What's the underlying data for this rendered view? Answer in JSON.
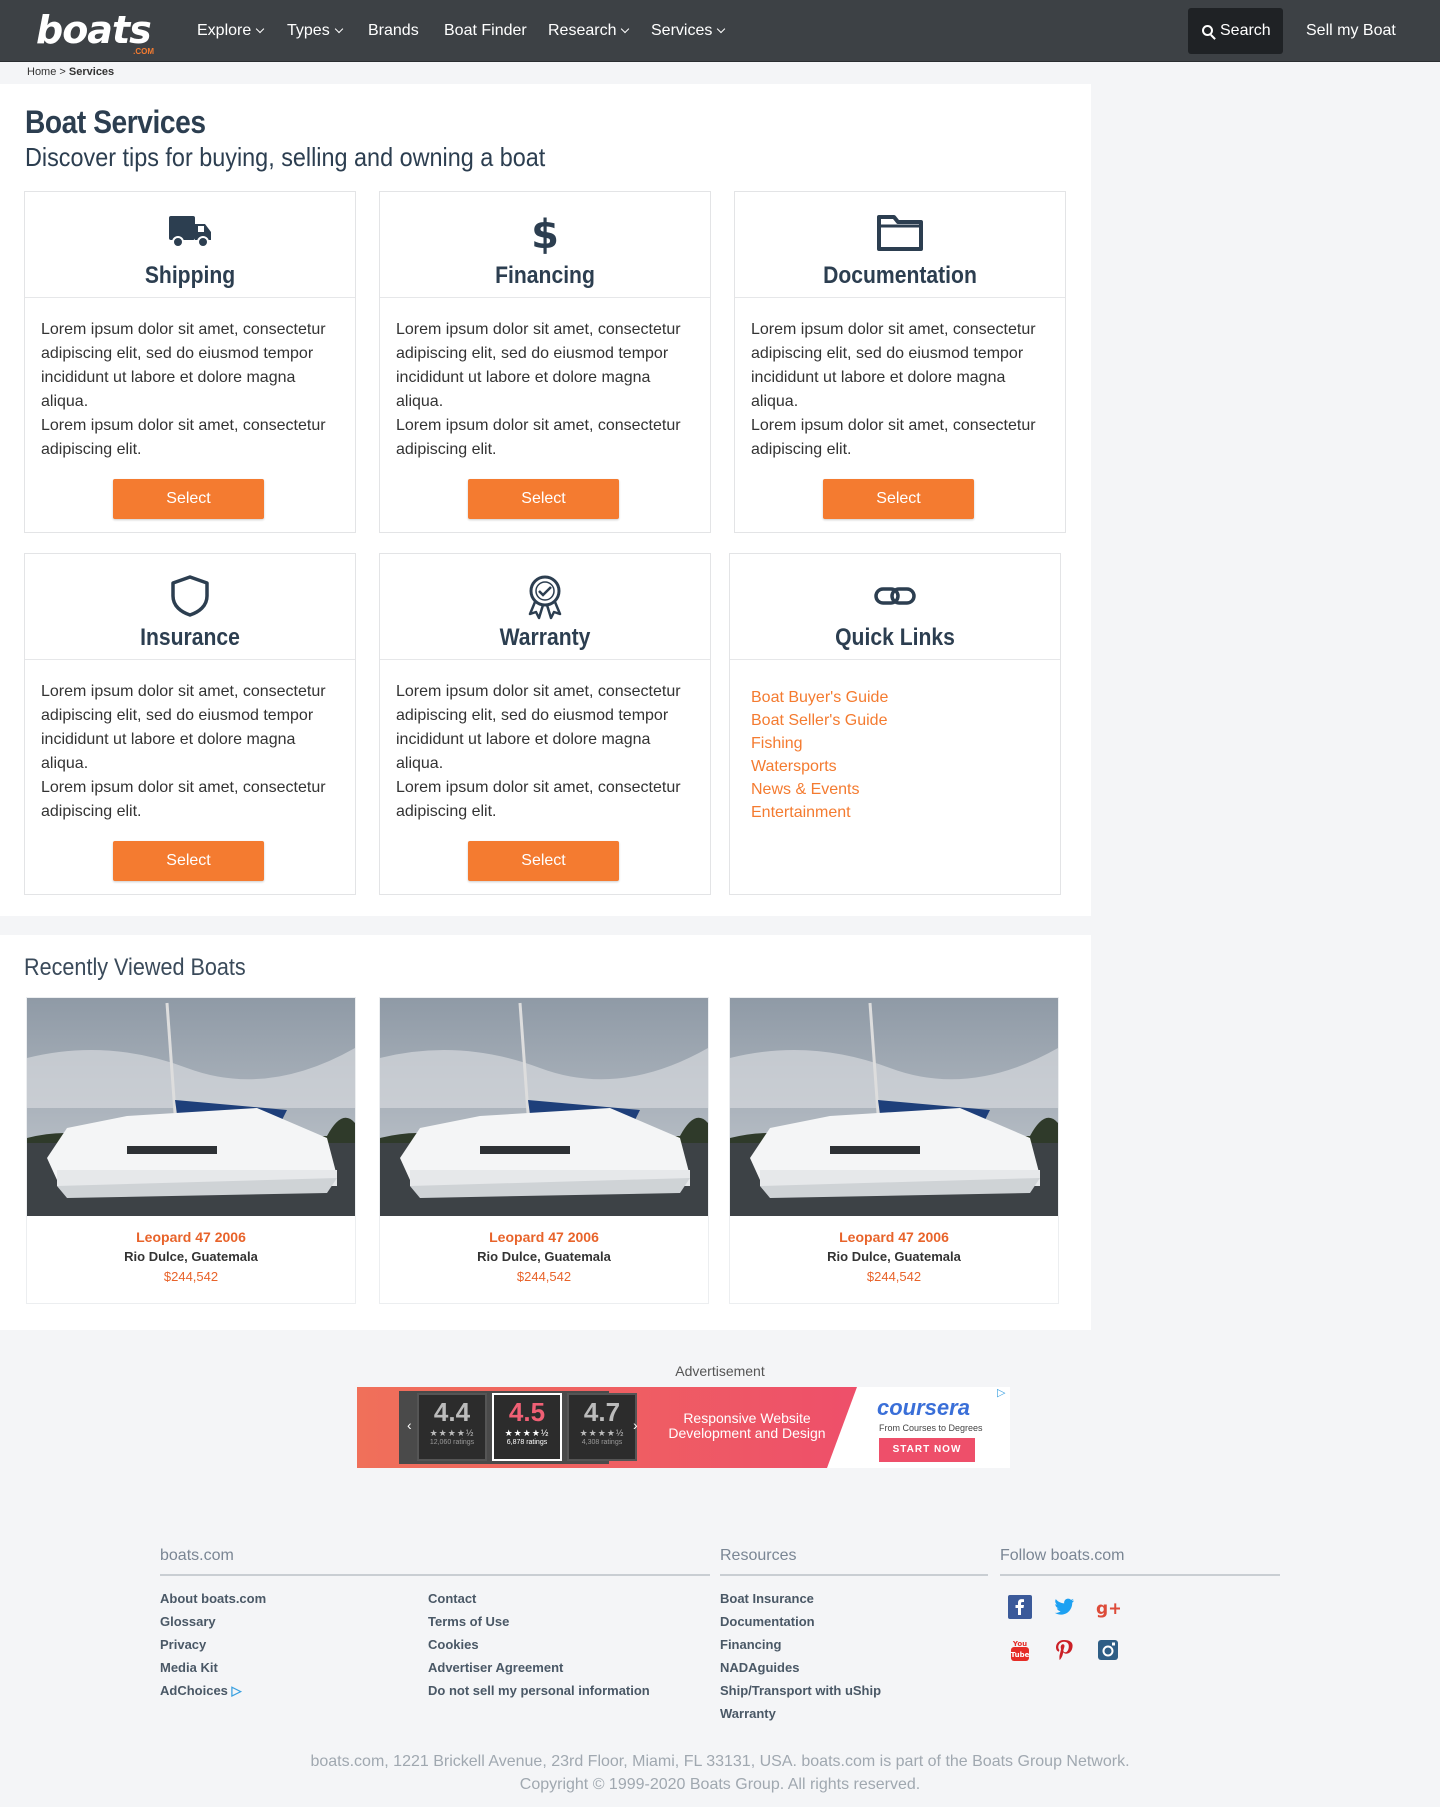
{
  "nav": {
    "logo": "boats",
    "logo_suffix": ".COM",
    "items": [
      {
        "label": "Explore",
        "dropdown": true
      },
      {
        "label": "Types",
        "dropdown": true
      },
      {
        "label": "Brands",
        "dropdown": false
      },
      {
        "label": "Boat Finder",
        "dropdown": false
      },
      {
        "label": "Research",
        "dropdown": true
      },
      {
        "label": "Services",
        "dropdown": true
      }
    ],
    "search_label": "Search",
    "sell_label": "Sell my Boat"
  },
  "breadcrumb": {
    "home": "Home",
    "sep": ">",
    "current": "Services"
  },
  "page": {
    "title": "Boat Services",
    "subtitle": "Discover tips for buying, selling and owning a boat"
  },
  "cards": [
    {
      "title": "Shipping",
      "icon": "truck-icon",
      "body": "Lorem ipsum dolor sit amet, consectetur adipiscing elit, sed do eiusmod tempor incididunt ut labore et dolore magna aliqua.",
      "body2": "Lorem ipsum dolor sit amet, consectetur adipiscing elit.",
      "button": "Select"
    },
    {
      "title": "Financing",
      "icon": "dollar-icon",
      "body": "Lorem ipsum dolor sit amet, consectetur adipiscing elit, sed do eiusmod tempor incididunt ut labore et dolore magna aliqua.",
      "body2": "Lorem ipsum dolor sit amet, consectetur adipiscing elit.",
      "button": "Select"
    },
    {
      "title": "Documentation",
      "icon": "folder-icon",
      "body": "Lorem ipsum dolor sit amet, consectetur adipiscing elit, sed do eiusmod tempor incididunt ut labore et dolore magna aliqua.",
      "body2": "Lorem ipsum dolor sit amet, consectetur adipiscing elit.",
      "button": "Select"
    },
    {
      "title": "Insurance",
      "icon": "shield-icon",
      "body": "Lorem ipsum dolor sit amet, consectetur adipiscing elit, sed do eiusmod tempor incididunt ut labore et dolore magna aliqua.",
      "body2": "Lorem ipsum dolor sit amet, consectetur adipiscing elit.",
      "button": "Select"
    },
    {
      "title": "Warranty",
      "icon": "award-ribbon-icon",
      "body": "Lorem ipsum dolor sit amet, consectetur adipiscing elit, sed do eiusmod tempor incididunt ut labore et dolore magna aliqua.",
      "body2": "Lorem ipsum dolor sit amet, consectetur adipiscing elit.",
      "button": "Select"
    }
  ],
  "quick_links": {
    "title": "Quick Links",
    "icon": "link-icon",
    "links": [
      "Boat Buyer's Guide",
      "Boat Seller's Guide",
      "Fishing",
      "Watersports",
      "News & Events",
      "Entertainment"
    ]
  },
  "recently_viewed": {
    "title": "Recently Viewed Boats",
    "boats": [
      {
        "name": "Leopard 47 2006",
        "location": "Rio Dulce, Guatemala",
        "price": "$244,542"
      },
      {
        "name": "Leopard 47 2006",
        "location": "Rio Dulce, Guatemala",
        "price": "$244,542"
      },
      {
        "name": "Leopard 47 2006",
        "location": "Rio Dulce, Guatemala",
        "price": "$244,542"
      }
    ]
  },
  "ad": {
    "label": "Advertisement",
    "ratings": [
      {
        "value": "4.4",
        "stars": "★★★★½",
        "count": "12,060 ratings"
      },
      {
        "value": "4.5",
        "stars": "★★★★½",
        "count": "6,878 ratings"
      },
      {
        "value": "4.7",
        "stars": "★★★★½",
        "count": "4,308 ratings"
      }
    ],
    "headline": "Responsive Website Development and Design",
    "brand": "coursera",
    "tagline": "From Courses to Degrees",
    "cta": "START NOW"
  },
  "footer": {
    "col1_title": "boats.com",
    "col1_links": [
      "About boats.com",
      "Glossary",
      "Privacy",
      "Media Kit",
      "AdChoices"
    ],
    "col2_links": [
      "Contact",
      "Terms of Use",
      "Cookies",
      "Advertiser Agreement",
      "Do not sell my personal information"
    ],
    "col3_title": "Resources",
    "col3_links": [
      "Boat Insurance",
      "Documentation",
      "Financing",
      "NADAguides",
      "Ship/Transport with uShip",
      "Warranty"
    ],
    "col4_title": "Follow boats.com",
    "social": [
      "facebook-icon",
      "twitter-icon",
      "google-plus-icon",
      "youtube-icon",
      "pinterest-icon",
      "instagram-icon"
    ],
    "address": "boats.com, 1221 Brickell Avenue, 23rd Floor, Miami, FL 33131, USA. boats.com is part of the Boats Group Network.",
    "copyright": "Copyright © 1999-2020 Boats Group. All rights reserved."
  },
  "colors": {
    "accent": "#f47b30",
    "nav_bg": "#3d4145",
    "heading": "#2c3e50"
  }
}
